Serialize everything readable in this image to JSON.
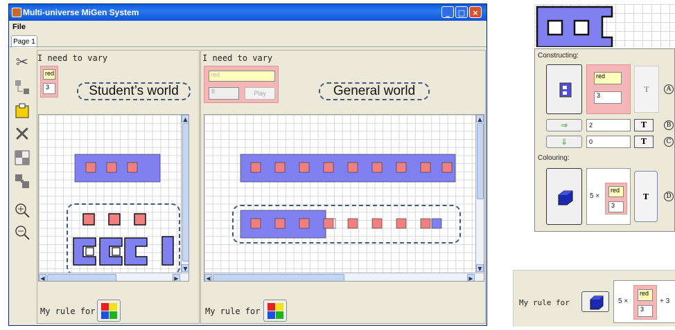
{
  "window": {
    "title": "Multi-universe MiGen System",
    "menu_file": "File",
    "tab": "Page 1",
    "min_glyph": "_",
    "max_glyph": "□",
    "close_glyph": "×"
  },
  "left_pane": {
    "need_to_vary": "I need to vary",
    "color": "red",
    "number": "3",
    "world_label": "Student’s world",
    "rule_label": "My rule for"
  },
  "right_pane": {
    "need_to_vary": "I need to vary",
    "color": "red",
    "number": "8",
    "play_label": "Play",
    "world_label": "General world",
    "rule_label": "My rule for"
  },
  "property_panel": {
    "constructing": "Constructing:",
    "color": "red",
    "number": "3",
    "t_label": "T",
    "move_right_value": "2",
    "move_down_value": "0",
    "colouring": "Colouring:",
    "times": "5 ×",
    "col_color": "red",
    "col_number": "3",
    "callouts": [
      "A",
      "B",
      "C",
      "D"
    ],
    "right_arrow": "⇒",
    "down_arrow": "⇓"
  },
  "bottom_rule": {
    "label": "My rule for",
    "times": "5 ×",
    "color": "red",
    "number": "3",
    "plus": "+ 3"
  },
  "colors": {
    "tile_blue": "#8080f0",
    "tile_red": "#f08080",
    "dash": "#3c5a80",
    "yellow_box": "#ffffbb",
    "pink_box": "#f4b6b6"
  },
  "icons": [
    "scissors-icon",
    "group-icon",
    "paste-icon",
    "delete-icon",
    "split-icon",
    "join-icon",
    "zoom-in-icon",
    "zoom-out-icon"
  ]
}
